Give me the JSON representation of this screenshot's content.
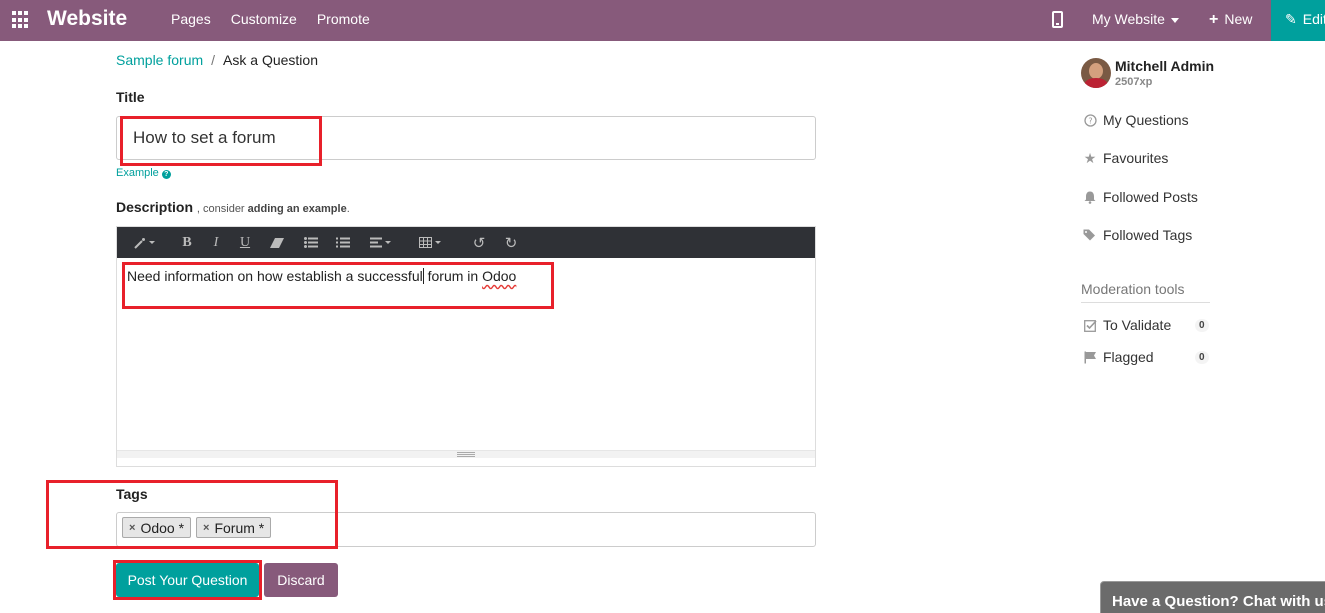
{
  "navbar": {
    "brand": "Website",
    "menu": [
      "Pages",
      "Customize",
      "Promote"
    ],
    "site_switch": "My Website",
    "new_label": "New",
    "edit_label": "Edit",
    "color": "#875a7b",
    "accent": "#00a09d"
  },
  "breadcrumb": {
    "parent": "Sample forum",
    "separator": "/",
    "current": "Ask a Question"
  },
  "form": {
    "title_label": "Title",
    "title_value": "How to set a forum",
    "example_label": "Example",
    "description_label": "Description",
    "description_hint_prefix": ", consider",
    "description_hint_bold": "adding an example",
    "description_hint_suffix": ".",
    "description_text_before_caret": "Need information on how establish a successful",
    "description_text_after_caret": " forum in ",
    "description_misspelled": "Odoo",
    "tags_label": "Tags",
    "tags": [
      "Odoo *",
      "Forum *"
    ],
    "post_button": "Post Your Question",
    "discard_button": "Discard"
  },
  "toolbar_icons": [
    "magic-wand-icon",
    "bold-icon",
    "italic-icon",
    "underline-icon",
    "eraser-icon",
    "bullet-list-icon",
    "numbered-list-icon",
    "align-icon",
    "table-icon",
    "undo-icon",
    "redo-icon"
  ],
  "toolbar_glyphs": {
    "bold": "B",
    "italic": "I",
    "underline": "U"
  },
  "sidebar": {
    "user_name": "Mitchell Admin",
    "user_xp": "2507xp",
    "items": [
      "My Questions",
      "Favourites",
      "Followed Posts",
      "Followed Tags"
    ],
    "moderation_title": "Moderation tools",
    "moderation": [
      {
        "label": "To Validate",
        "count": "0"
      },
      {
        "label": "Flagged",
        "count": "0"
      }
    ]
  },
  "chat_widget": "Have a Question? Chat with us."
}
